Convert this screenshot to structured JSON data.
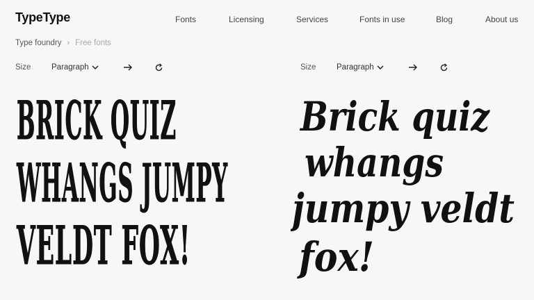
{
  "header": {
    "logo": "TypeType",
    "nav": [
      {
        "label": "Fonts"
      },
      {
        "label": "Licensing"
      },
      {
        "label": "Services"
      },
      {
        "label": "Fonts in use"
      },
      {
        "label": "Blog"
      },
      {
        "label": "About us"
      }
    ]
  },
  "breadcrumb": {
    "root": "Type foundry",
    "current": "Free fonts"
  },
  "left_panel": {
    "size_label": "Size",
    "mode": "Paragraph",
    "lines": [
      "BRICK QUIZ",
      "WHANGS JUMPY",
      "VELDT FOX!"
    ]
  },
  "right_panel": {
    "size_label": "Size",
    "mode": "Paragraph",
    "lines": [
      "Brick quiz",
      "whangs",
      "jumpy veldt",
      "fox!"
    ]
  },
  "colors": {
    "background": "#f7f7f7",
    "ink": "#111111",
    "muted": "#aaaaaa"
  },
  "icons": {
    "dropdown": "chevron-down-icon",
    "next": "arrow-right-icon",
    "reset": "refresh-icon"
  }
}
